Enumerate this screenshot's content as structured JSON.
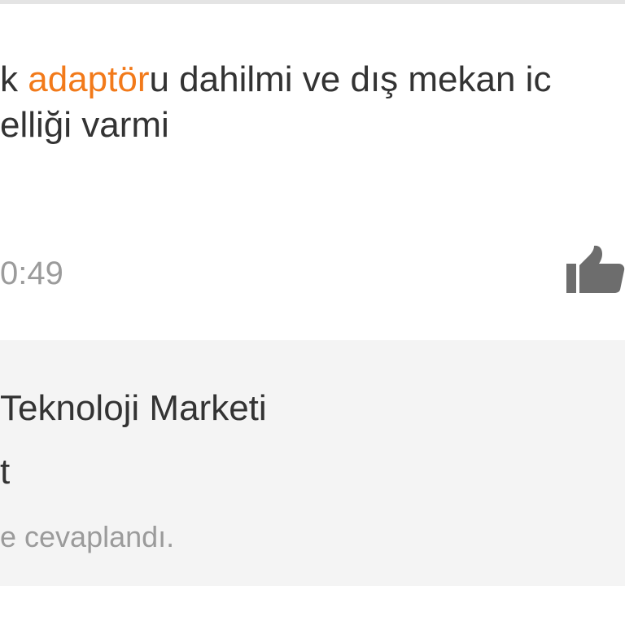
{
  "question": {
    "line1_prefix": "k ",
    "line1_highlight": "adaptör",
    "line1_suffix": "u dahilmi ve dış mekan ic",
    "line2": "elliği varmi",
    "timestamp": "0:49",
    "highlight_color": "#f27a1a"
  },
  "actions": {
    "like_icon": "thumbs-up-icon"
  },
  "answer": {
    "seller_name": "Teknoloji Marketi",
    "text": "t",
    "answered_info": "e cevaplandı."
  }
}
